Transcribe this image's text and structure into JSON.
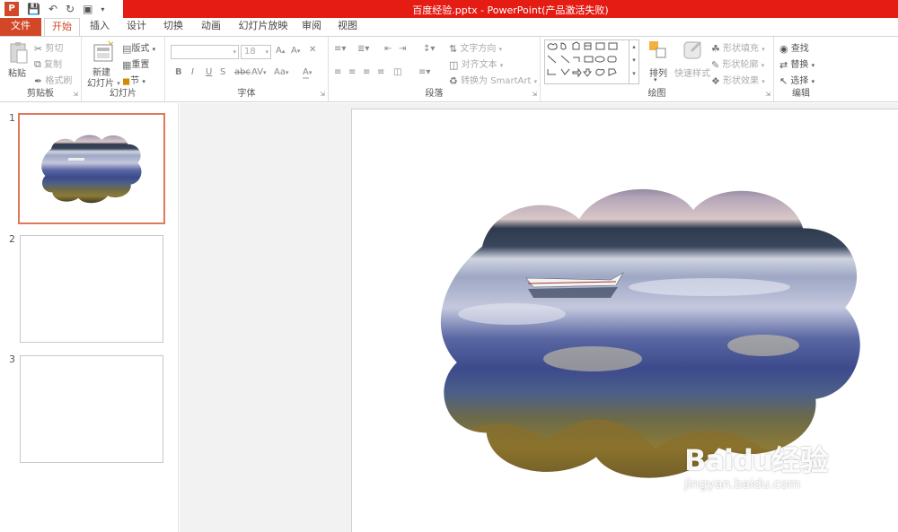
{
  "titlebar": {
    "title": "百度经验.pptx -  PowerPoint(产品激活失败)",
    "app_icon_letter": "P"
  },
  "tabs": [
    {
      "label": "文件"
    },
    {
      "label": "开始"
    },
    {
      "label": "插入"
    },
    {
      "label": "设计"
    },
    {
      "label": "切换"
    },
    {
      "label": "动画"
    },
    {
      "label": "幻灯片放映"
    },
    {
      "label": "审阅"
    },
    {
      "label": "视图"
    }
  ],
  "ribbon": {
    "clipboard": {
      "paste": "粘贴",
      "cut": "剪切",
      "copy": "复制",
      "format_painter": "格式刷",
      "label": "剪贴板"
    },
    "slides": {
      "new_slide_1": "新建",
      "new_slide_2": "幻灯片",
      "layout": "版式",
      "reset": "重置",
      "section": "节",
      "label": "幻灯片"
    },
    "font": {
      "font_size": "18",
      "bold": "B",
      "italic": "I",
      "underline": "U",
      "shadow": "S",
      "strike": "abc",
      "spacing": "AV",
      "case": "Aa",
      "grow": "A",
      "shrink": "A",
      "color": "A",
      "label": "字体"
    },
    "paragraph": {
      "text_direction": "文字方向",
      "align_text": "对齐文本",
      "smartart": "转换为 SmartArt",
      "label": "段落"
    },
    "drawing": {
      "arrange": "排列",
      "quick_styles": "快速样式",
      "shape_fill": "形状填充",
      "shape_outline": "形状轮廓",
      "shape_effects": "形状效果",
      "label": "绘图"
    },
    "editing": {
      "find": "查找",
      "replace": "替换",
      "select": "选择",
      "label": "编辑"
    }
  },
  "slides": [
    {
      "number": "1"
    },
    {
      "number": "2"
    },
    {
      "number": "3"
    }
  ],
  "watermark": {
    "main": "Baidu经验",
    "sub": "jingyan.baidu.com"
  }
}
